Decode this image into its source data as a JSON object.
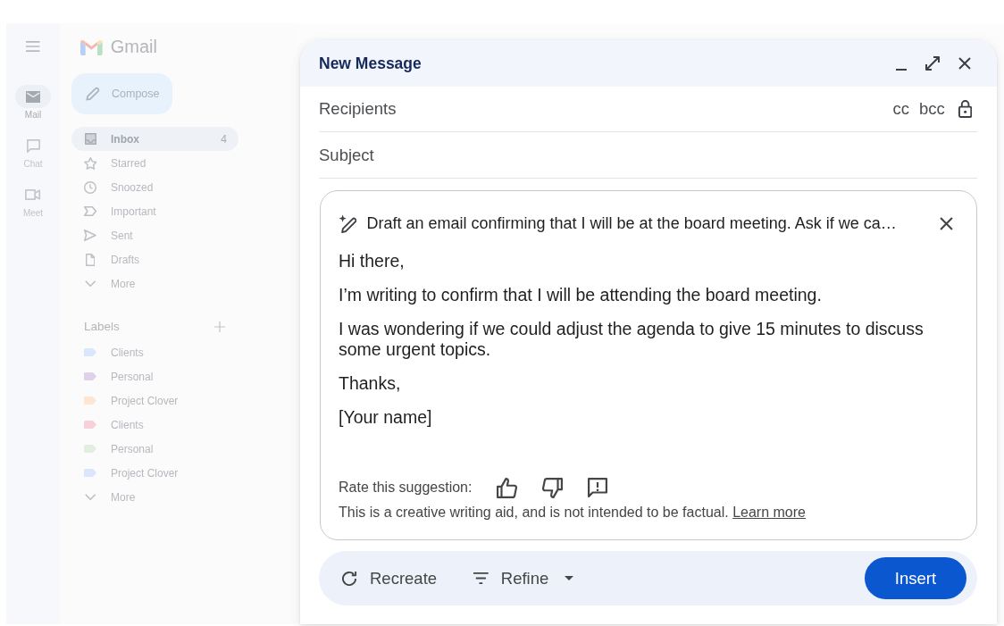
{
  "rail": [
    {
      "label": "Mail",
      "selected": true
    },
    {
      "label": "Chat",
      "selected": false
    },
    {
      "label": "Meet",
      "selected": false
    }
  ],
  "brand": {
    "name": "Gmail"
  },
  "compose_button": {
    "label": "Compose"
  },
  "folders": {
    "items": [
      {
        "label": "Inbox",
        "count": "4",
        "selected": true
      },
      {
        "label": "Starred",
        "selected": false
      },
      {
        "label": "Snoozed",
        "selected": false
      },
      {
        "label": "Important",
        "selected": false
      },
      {
        "label": "Sent",
        "selected": false
      },
      {
        "label": "Drafts",
        "selected": false
      }
    ],
    "more": "More"
  },
  "labels": {
    "title": "Labels",
    "items": [
      {
        "label": "Clients",
        "color": "#d9e6fb"
      },
      {
        "label": "Personal",
        "color": "#e0d0eb"
      },
      {
        "label": "Project Clover",
        "color": "#fde6d3"
      },
      {
        "label": "Clients",
        "color": "#f7d0d9"
      },
      {
        "label": "Personal",
        "color": "#e0efde"
      },
      {
        "label": "Project Clover",
        "color": "#d9e6fb"
      }
    ],
    "more": "More"
  },
  "compose": {
    "title": "New Message",
    "recipients": {
      "placeholder": "Recipients"
    },
    "cc": "cc",
    "bcc": "bcc",
    "subject": {
      "placeholder": "Subject"
    },
    "assistant": {
      "prompt": "Draft an email confirming that I will be at the board meeting. Ask if we ca…",
      "draft": [
        "Hi there,",
        "I’m writing to confirm that I will be attending the board meeting.",
        "I was wondering if we could adjust the agenda to give 15 minutes to discuss some urgent topics.",
        "Thanks,",
        "[Your name]"
      ],
      "rating_label": "Rate this suggestion:",
      "disclaimer": "This is a creative writing aid, and is not intended to be factual.",
      "learn_more": "Learn more"
    },
    "actions": {
      "recreate": "Recreate",
      "refine": "Refine",
      "insert": "Insert"
    }
  }
}
